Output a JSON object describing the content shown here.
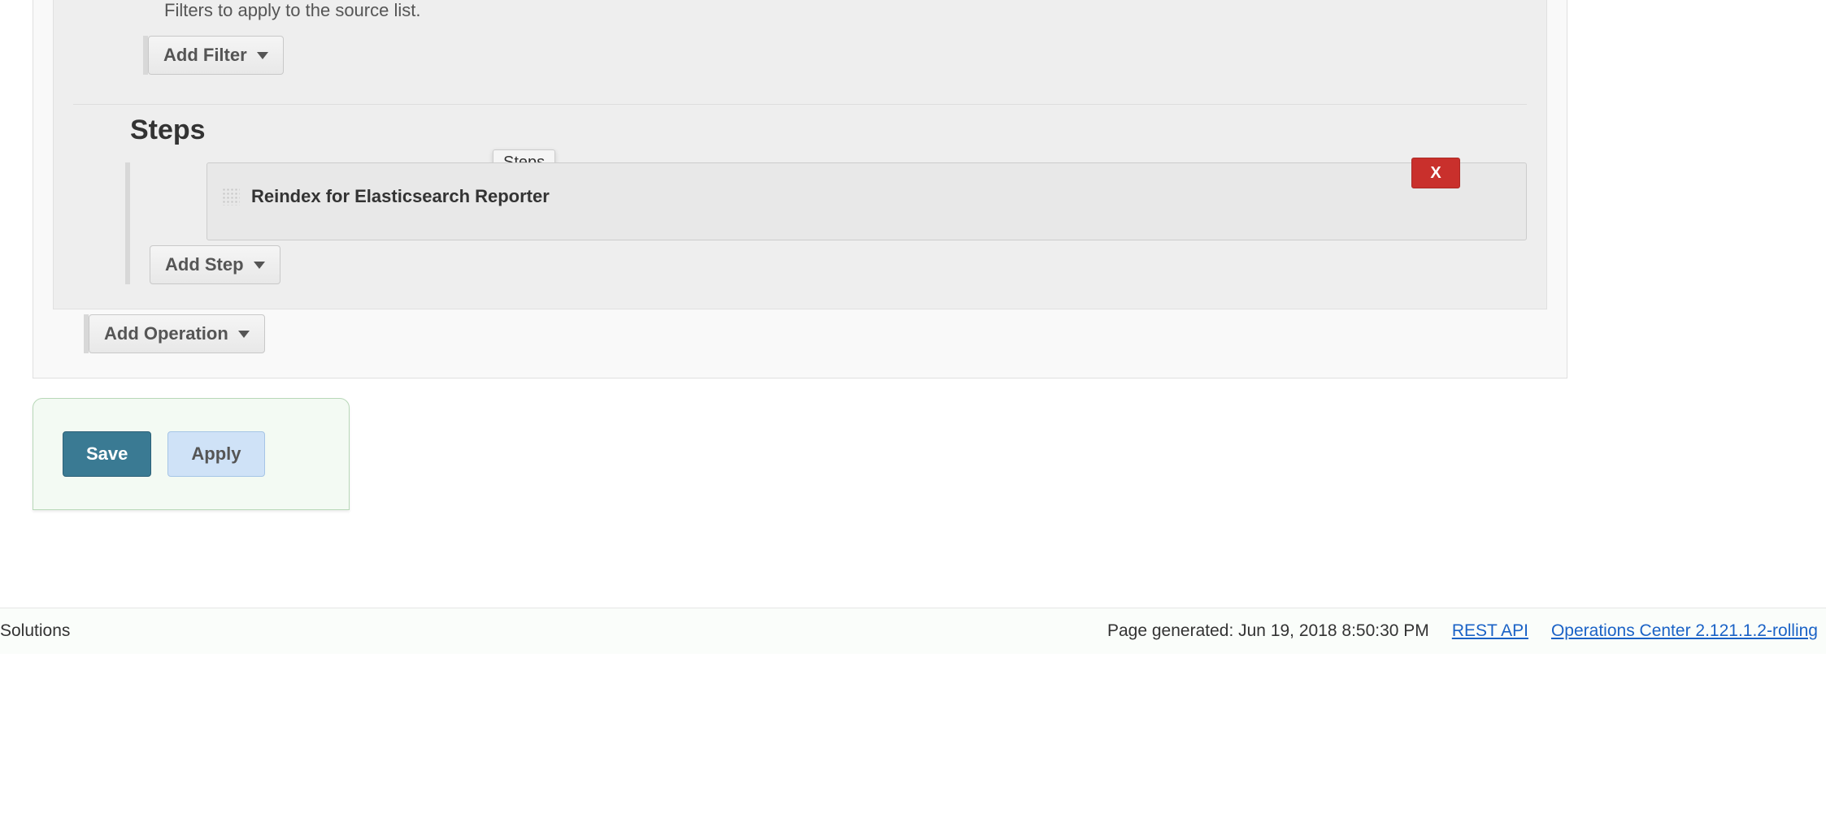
{
  "filters": {
    "help_text": "Filters to apply to the source list.",
    "add_label": "Add Filter"
  },
  "steps": {
    "heading": "Steps",
    "tooltip": "Steps",
    "items": [
      {
        "title": "Reindex for Elasticsearch Reporter",
        "delete_label": "X"
      }
    ],
    "add_label": "Add Step"
  },
  "operations": {
    "add_label": "Add Operation"
  },
  "actions": {
    "save": "Save",
    "apply": "Apply"
  },
  "footer": {
    "left_text": "Solutions",
    "generated": "Page generated: Jun 19, 2018 8:50:30 PM",
    "rest_api": "REST API",
    "version": "Operations Center 2.121.1.2-rolling"
  }
}
